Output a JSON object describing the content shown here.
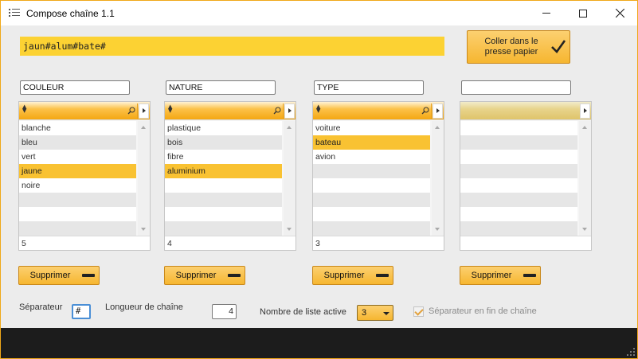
{
  "window": {
    "title": "Compose chaîne 1.1",
    "accent_color": "#f4a712",
    "highlight_color": "#fcd233"
  },
  "result": {
    "value": "jaun#alum#bate#"
  },
  "copy_button": {
    "label": "Coller dans le presse papier",
    "icon": "check-icon"
  },
  "lists": [
    {
      "header": "COULEUR",
      "items": [
        "blanche",
        "bleu",
        "vert",
        "jaune",
        "noire"
      ],
      "selected": "jaune",
      "count": "5",
      "delete_label": "Supprimer"
    },
    {
      "header": "NATURE",
      "items": [
        "plastique",
        "bois",
        "fibre",
        "aluminium"
      ],
      "selected": "aluminium",
      "count": "4",
      "delete_label": "Supprimer"
    },
    {
      "header": "TYPE",
      "items": [
        "voiture",
        "bateau",
        "avion"
      ],
      "selected": "bateau",
      "count": "3",
      "delete_label": "Supprimer"
    },
    {
      "header": "",
      "items": [],
      "selected": "",
      "count": "",
      "delete_label": "Supprimer"
    }
  ],
  "options": {
    "separator_label": "Séparateur",
    "separator_value": "#",
    "length_label": "Longueur de chaîne",
    "length_value": "4",
    "active_lists_label": "Nombre de liste active",
    "active_lists_value": "3",
    "trailing_separator_label": "Séparateur en fin de chaîne",
    "trailing_separator_checked": true
  }
}
